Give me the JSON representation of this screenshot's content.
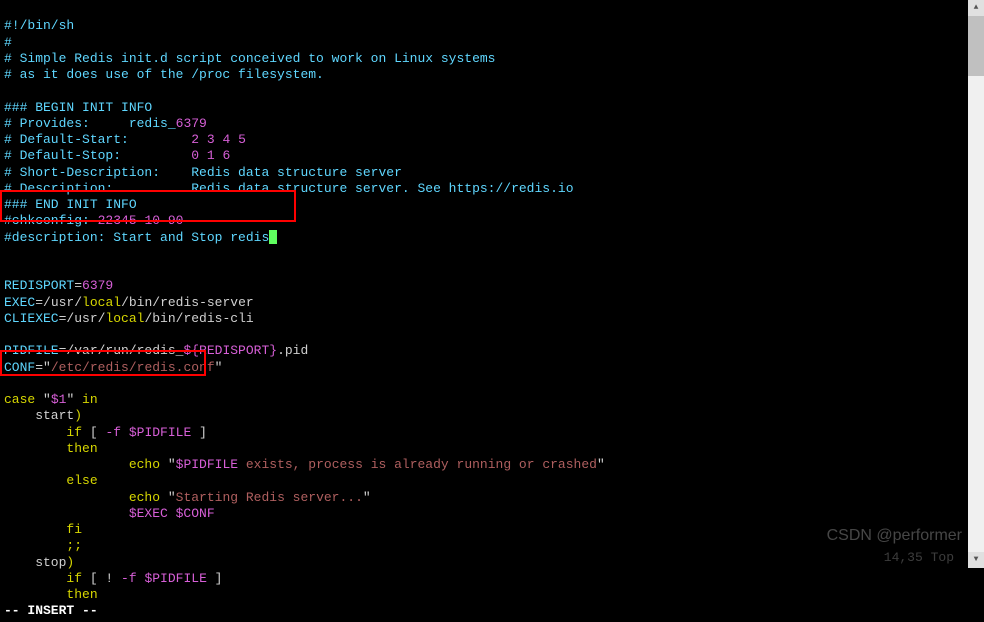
{
  "lines": {
    "l1": "#!/bin/sh",
    "l2": "#",
    "l3": "# Simple Redis init.d script conceived to work on Linux systems",
    "l4": "# as it does use of the /proc filesystem.",
    "l5": "",
    "l6": "### BEGIN INIT INFO",
    "l7_a": "# Provides:     redis_",
    "l7_b": "6379",
    "l8_a": "# Default-Start:        ",
    "l8_b": "2",
    "l8_c": " 3",
    "l8_d": " 4",
    "l8_e": " 5",
    "l9_a": "# Default-Stop:         ",
    "l9_b": "0",
    "l9_c": " 1",
    "l9_d": " 6",
    "l10": "# Short-Description:    Redis data structure server",
    "l11": "# Description:          Redis data structure server. See https://redis.io",
    "l12": "### END INIT INFO",
    "l13_a": "#chkconfig: ",
    "l13_b": "22345",
    "l13_c": " 10",
    "l13_d": " 90",
    "l14": "#description: Start and Stop redis",
    "l15": "",
    "l16": "",
    "l17_a": "REDISPORT",
    "l17_b": "=",
    "l17_c": "6379",
    "l18_a": "EXEC",
    "l18_b": "=",
    "l18_c": "/usr/",
    "l18_d": "local",
    "l18_e": "/bin/redis-server",
    "l19_a": "CLIEXEC",
    "l19_b": "=",
    "l19_c": "/usr/",
    "l19_d": "local",
    "l19_e": "/bin/redis-cli",
    "l20": "",
    "l21_a": "PIDFILE",
    "l21_b": "=",
    "l21_c": "/var/run/redis_",
    "l21_d": "${REDISPORT}",
    "l21_e": ".pid",
    "l22_a": "CONF",
    "l22_b": "=",
    "l22_c": "\"",
    "l22_d": "/etc/redis/redis.conf",
    "l22_e": "\"",
    "l23": "",
    "l24_a": "case",
    "l24_b": " \"",
    "l24_c": "$1",
    "l24_d": "\" ",
    "l24_e": "in",
    "l25_a": "    start",
    "l25_b": ")",
    "l26_a": "        ",
    "l26_b": "if",
    "l26_c": " [ ",
    "l26_d": "-f",
    "l26_e": " $PIDFILE",
    "l26_f": " ]",
    "l27_a": "        ",
    "l27_b": "then",
    "l28_a": "                ",
    "l28_b": "echo",
    "l28_c": " \"",
    "l28_d": "$PIDFILE",
    "l28_e": " exists, process is already running or crashed",
    "l28_f": "\"",
    "l29_a": "        ",
    "l29_b": "else",
    "l30_a": "                ",
    "l30_b": "echo",
    "l30_c": " \"",
    "l30_d": "Starting Redis server...",
    "l30_e": "\"",
    "l31_a": "                ",
    "l31_b": "$EXEC $CONF",
    "l32_a": "        ",
    "l32_b": "fi",
    "l33_a": "        ",
    "l33_b": ";;",
    "l34_a": "    stop",
    "l34_b": ")",
    "l35_a": "        ",
    "l35_b": "if",
    "l35_c": " [ ! ",
    "l35_d": "-f",
    "l35_e": " $PIDFILE",
    "l35_f": " ]",
    "l36_a": "        ",
    "l36_b": "then"
  },
  "status": {
    "mode": "-- INSERT --",
    "pos": "14,35        Top"
  },
  "watermark": "CSDN @performer"
}
